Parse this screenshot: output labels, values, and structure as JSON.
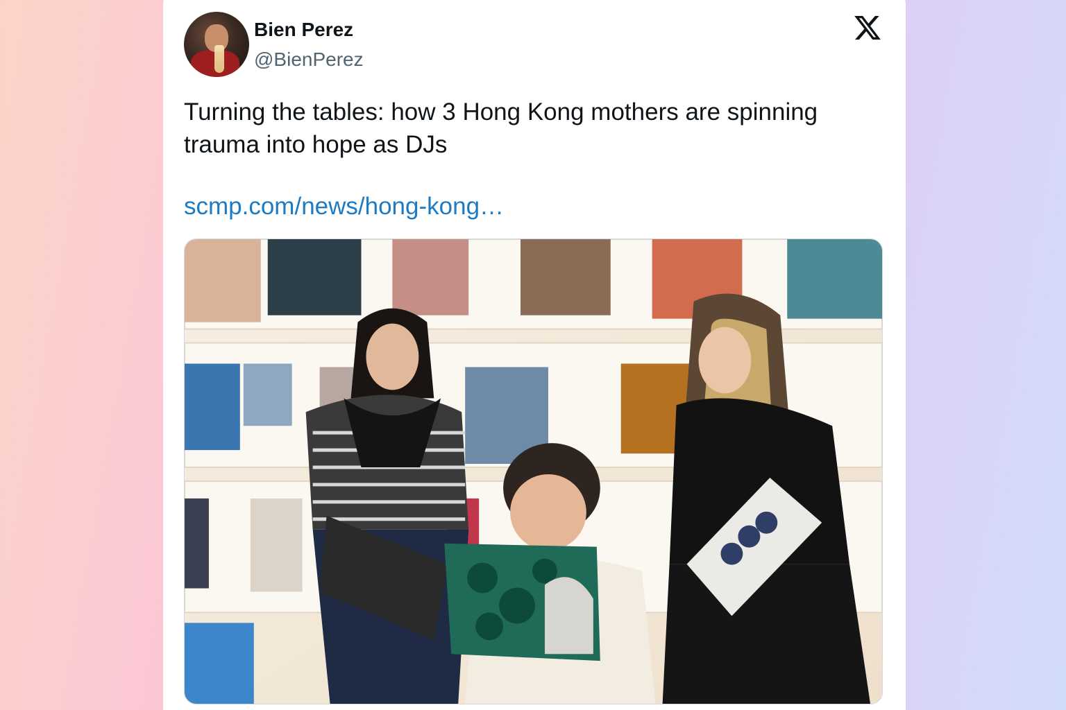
{
  "tweet": {
    "author_name": "Bien Perez",
    "author_handle": "@BienPerez",
    "text": "Turning the tables: how 3 Hong Kong mothers are spinning trauma into hope as DJs",
    "link_text": "scmp.com/news/hong-kong…",
    "platform_icon": "x-logo-icon",
    "avatar_icon": "profile-avatar",
    "photo_icon": "article-photo-women-holding-vinyl-records"
  },
  "colors": {
    "link": "#1d7bc4",
    "text": "#0f1419",
    "secondary_text": "#536471"
  }
}
